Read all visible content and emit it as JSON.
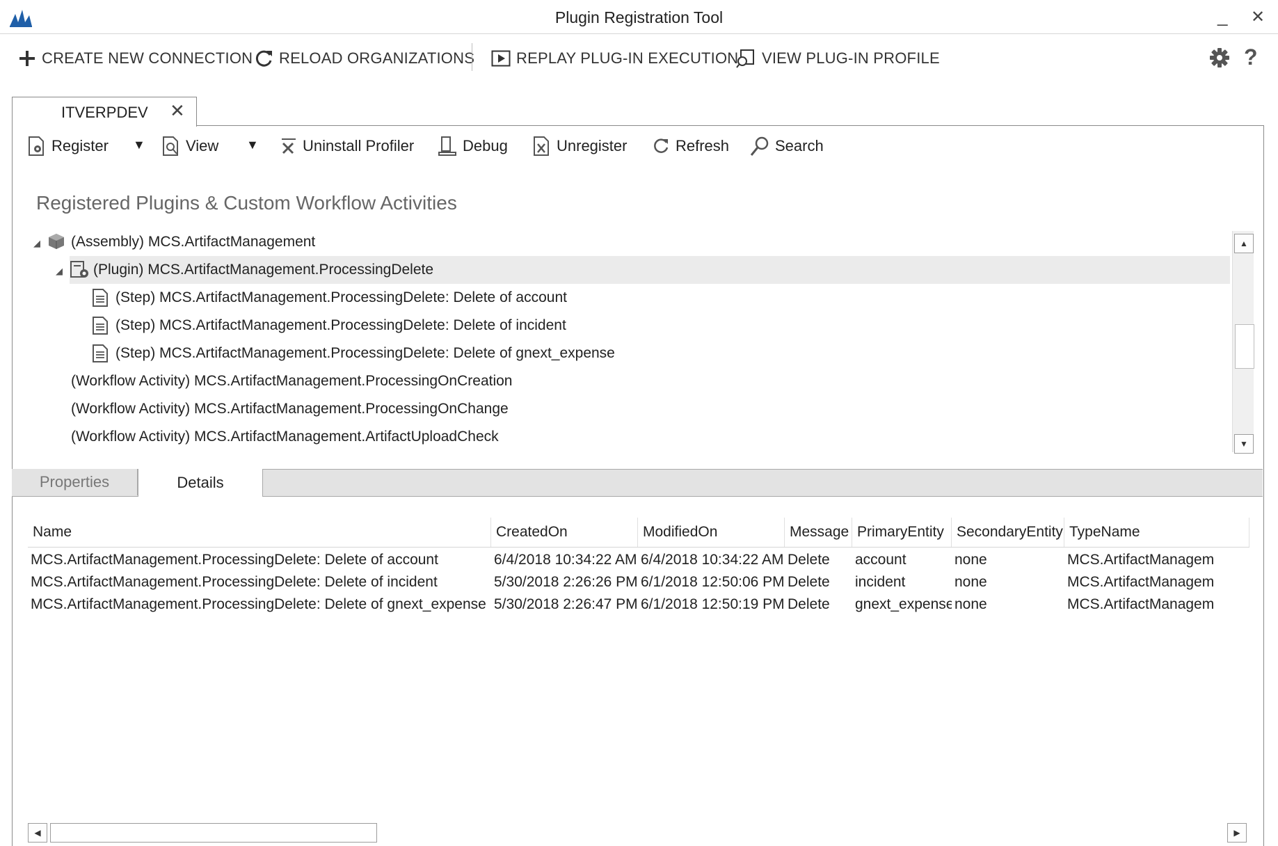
{
  "window": {
    "title": "Plugin Registration Tool",
    "minimize_glyph": "_",
    "close_glyph": "✕"
  },
  "top_toolbar": {
    "create_new_connection": "CREATE NEW CONNECTION",
    "reload_organizations": "RELOAD ORGANIZATIONS",
    "replay_plugin_execution": "REPLAY PLUG-IN EXECUTION",
    "view_plugin_profile": "VIEW PLUG-IN PROFILE",
    "help": "?"
  },
  "connection_tab": {
    "label": "ITVERPDEV",
    "close_glyph": "✕"
  },
  "secondary_toolbar": {
    "register": "Register",
    "view": "View",
    "uninstall_profiler": "Uninstall Profiler",
    "debug": "Debug",
    "unregister": "Unregister",
    "refresh": "Refresh",
    "search": "Search"
  },
  "tree": {
    "heading": "Registered Plugins & Custom Workflow Activities",
    "items": [
      {
        "label": "(Assembly) MCS.ArtifactManagement",
        "kind": "assembly",
        "depth": 0,
        "expanded": true,
        "selected": false
      },
      {
        "label": "(Plugin) MCS.ArtifactManagement.ProcessingDelete",
        "kind": "plugin",
        "depth": 1,
        "expanded": true,
        "selected": true
      },
      {
        "label": "(Step) MCS.ArtifactManagement.ProcessingDelete: Delete of account",
        "kind": "step",
        "depth": 2,
        "selected": false
      },
      {
        "label": "(Step) MCS.ArtifactManagement.ProcessingDelete: Delete of incident",
        "kind": "step",
        "depth": 2,
        "selected": false
      },
      {
        "label": "(Step) MCS.ArtifactManagement.ProcessingDelete: Delete of gnext_expense",
        "kind": "step",
        "depth": 2,
        "selected": false
      },
      {
        "label": "(Workflow Activity) MCS.ArtifactManagement.ProcessingOnCreation",
        "kind": "workflow",
        "depth": 1,
        "selected": false
      },
      {
        "label": "(Workflow Activity) MCS.ArtifactManagement.ProcessingOnChange",
        "kind": "workflow",
        "depth": 1,
        "selected": false
      },
      {
        "label": "(Workflow Activity) MCS.ArtifactManagement.ArtifactUploadCheck",
        "kind": "workflow",
        "depth": 1,
        "selected": false
      }
    ]
  },
  "bottom_tabs": {
    "properties": "Properties",
    "details": "Details",
    "active": "details"
  },
  "details_grid": {
    "columns": [
      "Name",
      "CreatedOn",
      "ModifiedOn",
      "Message",
      "PrimaryEntity",
      "SecondaryEntity",
      "TypeName"
    ],
    "rows": [
      [
        "MCS.ArtifactManagement.ProcessingDelete: Delete of account",
        "6/4/2018 10:34:22 AM",
        "6/4/2018 10:34:22 AM",
        "Delete",
        "account",
        "none",
        "MCS.ArtifactManagem"
      ],
      [
        "MCS.ArtifactManagement.ProcessingDelete: Delete of incident",
        "5/30/2018 2:26:26 PM",
        "6/1/2018 12:50:06 PM",
        "Delete",
        "incident",
        "none",
        "MCS.ArtifactManagem"
      ],
      [
        "MCS.ArtifactManagement.ProcessingDelete: Delete of gnext_expense",
        "5/30/2018 2:26:47 PM",
        "6/1/2018 12:50:19 PM",
        "Delete",
        "gnext_expense",
        "none",
        "MCS.ArtifactManagem"
      ]
    ]
  },
  "colors": {
    "accent": "#1f5fa8",
    "selected_row": "#ebebeb",
    "border": "#8a8a8a"
  }
}
